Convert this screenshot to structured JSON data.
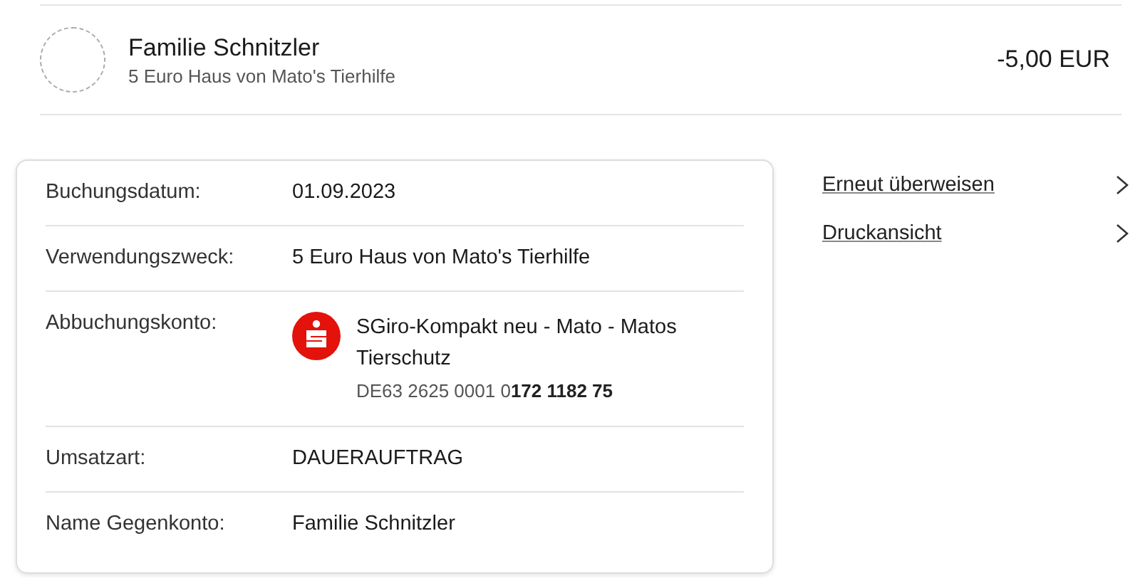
{
  "header": {
    "name": "Familie Schnitzler",
    "purpose": "5 Euro Haus von Mato's Tierhilfe",
    "amount": "-5,00 EUR"
  },
  "details": [
    {
      "kind": "text",
      "label": "Buchungsdatum:",
      "value": "01.09.2023"
    },
    {
      "kind": "text",
      "label": "Verwendungszweck:",
      "value": "5 Euro Haus von Mato's Tierhilfe"
    },
    {
      "kind": "account",
      "label": "Abbuchungskonto:",
      "value": "SGiro-Kompakt neu - Mato - Matos Tierschutz",
      "iban": "DE63 2625 0001 0**172 1182 75**"
    },
    {
      "kind": "text",
      "label": "Umsatzart:",
      "value": "DAUERAUFTRAG"
    },
    {
      "kind": "text",
      "label": "Name Gegenkonto:",
      "value": "Familie Schnitzler"
    }
  ],
  "actions": [
    "Erneut überweisen",
    "Druckansicht"
  ]
}
